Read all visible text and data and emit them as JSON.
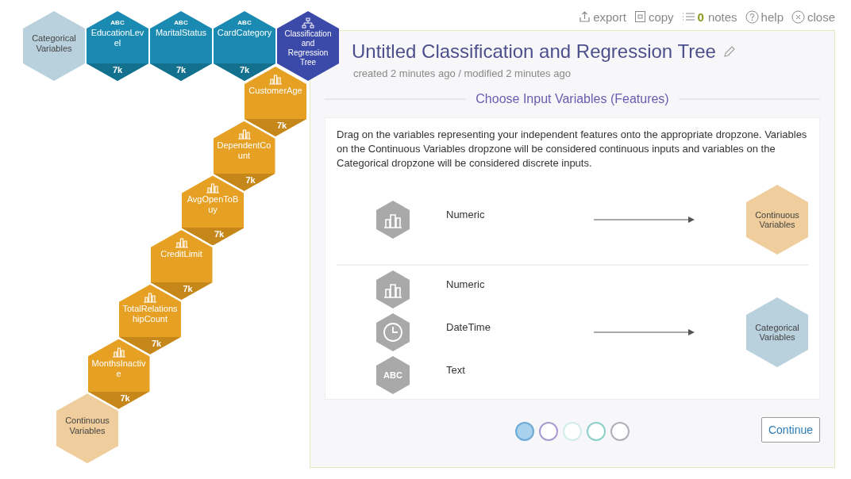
{
  "toolbar": [
    {
      "kind": "export",
      "label": "export"
    },
    {
      "kind": "copy",
      "label": "copy"
    },
    {
      "kind": "notes",
      "count": "0",
      "label": "notes"
    },
    {
      "kind": "help",
      "label": "help"
    },
    {
      "kind": "close",
      "label": "close"
    }
  ],
  "top_row": [
    {
      "kind": "categorical-dropzone",
      "label": "Categorical Variables"
    },
    {
      "kind": "text",
      "badge": "ABC",
      "label": "EducationLevel",
      "count": "7k"
    },
    {
      "kind": "text",
      "badge": "ABC",
      "label": "MaritalStatus",
      "count": "7k"
    },
    {
      "kind": "text",
      "badge": "ABC",
      "label": "CardCategory",
      "count": "7k"
    },
    {
      "kind": "model",
      "label": "Classification and Regression Tree"
    }
  ],
  "chain": [
    {
      "kind": "numeric",
      "label": "CustomerAge",
      "count": "7k"
    },
    {
      "kind": "numeric",
      "label": "DependentCount",
      "count": "7k"
    },
    {
      "kind": "numeric",
      "label": "AvgOpenToBuy",
      "count": "7k"
    },
    {
      "kind": "numeric",
      "label": "CreditLimit",
      "count": "7k"
    },
    {
      "kind": "numeric",
      "label": "TotalRelationshipCount",
      "count": "7k"
    },
    {
      "kind": "numeric",
      "label": "MonthsInactive",
      "count": "7k"
    },
    {
      "kind": "continuous-dropzone",
      "label": "Continuous Variables"
    }
  ],
  "panel": {
    "title": "Untitled Classification and Regression Tree",
    "subtitle": "created 2 minutes ago / modified 2 minutes ago",
    "section": "Choose Input Variables (Features)",
    "instructions": "Drag on the variables representing your independent features onto the appropriate dropzone. Variables on the Continuous Variables dropzone will be considered continuous inputs and variables on the Categorical dropzone will be considered discrete inputs.",
    "groups": [
      {
        "rows": [
          {
            "kind": "numeric",
            "label": "Numeric"
          }
        ],
        "target": {
          "kind": "continuous-dropzone",
          "label": "Continuous Variables"
        }
      },
      {
        "rows": [
          {
            "kind": "numeric",
            "label": "Numeric"
          },
          {
            "kind": "datetime",
            "label": "DateTime"
          },
          {
            "kind": "text",
            "badge": "ABC",
            "label": "Text"
          }
        ],
        "target": {
          "kind": "categorical-dropzone",
          "label": "Categorical Variables"
        }
      }
    ],
    "steps": [
      {
        "selected": true,
        "color": "#6aa9d8"
      },
      {
        "selected": false,
        "color": "#a99bd0"
      },
      {
        "selected": false,
        "color": "#d2ece8"
      },
      {
        "selected": false,
        "color": "#8ccfc8"
      },
      {
        "selected": false,
        "color": "#b0b0b8"
      }
    ],
    "continue": "Continue"
  }
}
